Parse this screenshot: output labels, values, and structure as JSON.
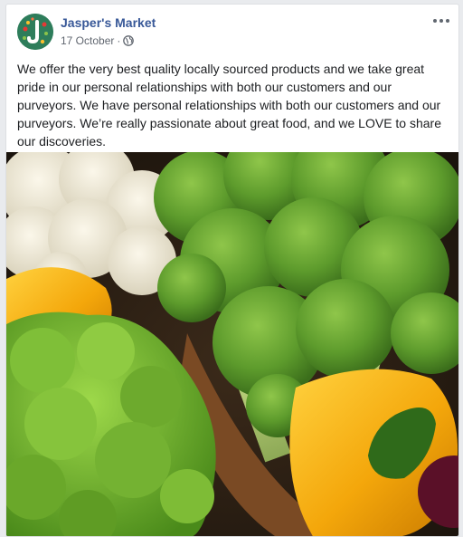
{
  "post": {
    "page_name": "Jasper's Market",
    "date": "17 October",
    "separator": "·",
    "privacy_icon": "globe-icon",
    "more_icon": "more-options-icon",
    "text": "We offer the very best quality locally sourced products and we take great pride in our personal relationships with both our customers and our purveyors. We have personal relationships with both our customers and our purveyors. We’re really passionate about great food, and we LOVE to share our discoveries.",
    "image_icon": "vegetables-photo"
  },
  "colors": {
    "link": "#385898",
    "meta": "#616770",
    "text": "#1c1e21",
    "avatar_bg": "#2e7d5b"
  }
}
